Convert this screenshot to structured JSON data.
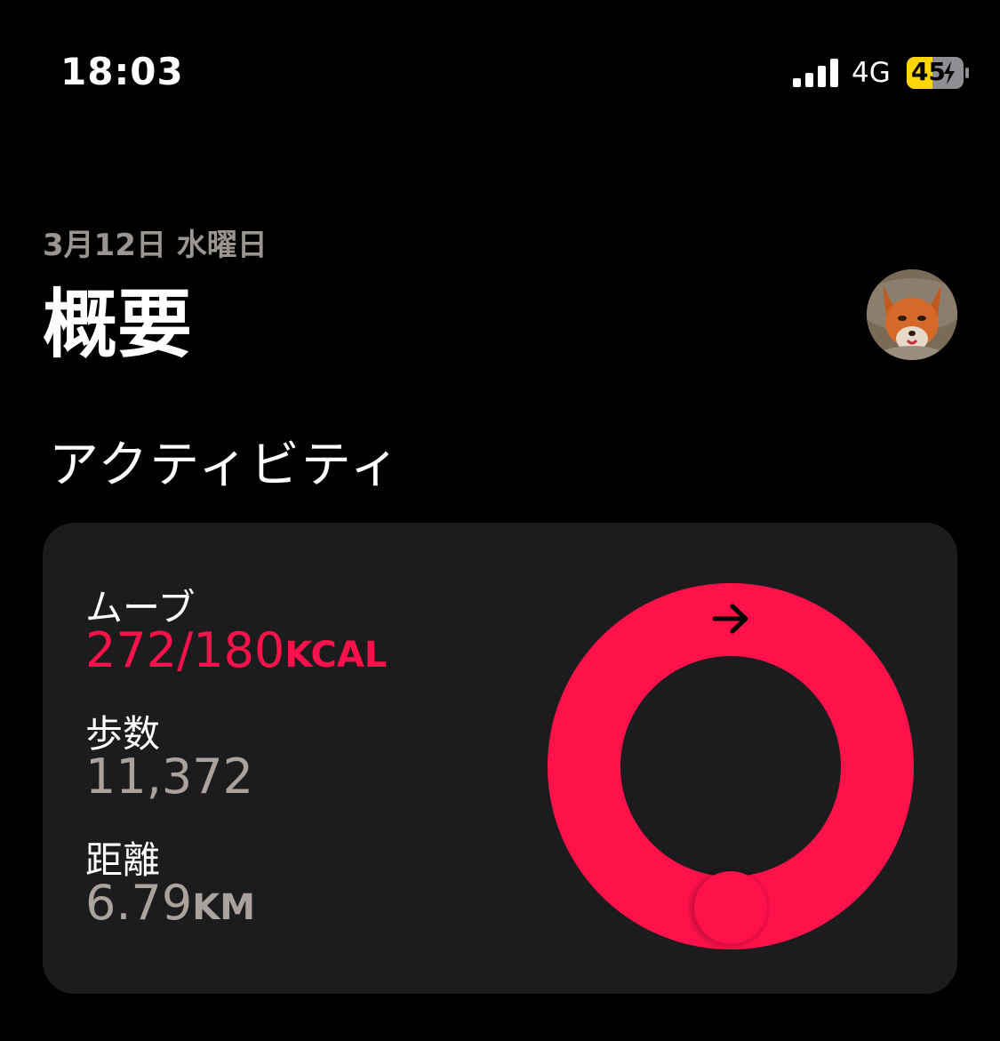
{
  "status_bar": {
    "time": "18:03",
    "network": "4G",
    "battery_level": "45",
    "signal_icon": "signal-bars-icon",
    "battery_icon": "battery-charging-icon"
  },
  "header": {
    "date": "3月12日 水曜日",
    "title": "概要",
    "avatar_icon": "fox-avatar"
  },
  "activity": {
    "section_title": "アクティビティ",
    "move": {
      "label": "ムーブ",
      "value": "272/180",
      "unit": "KCAL",
      "progress": 1.51
    },
    "steps": {
      "label": "歩数",
      "value": "11,372"
    },
    "distance": {
      "label": "距離",
      "value": "6.79",
      "unit": "KM"
    },
    "ring_icon": "arrow-right-icon"
  },
  "colors": {
    "move_red": "#ff1149",
    "card_bg": "#1c1c1e",
    "secondary_text": "#aaa39d",
    "battery_yellow": "#ffd60a"
  }
}
